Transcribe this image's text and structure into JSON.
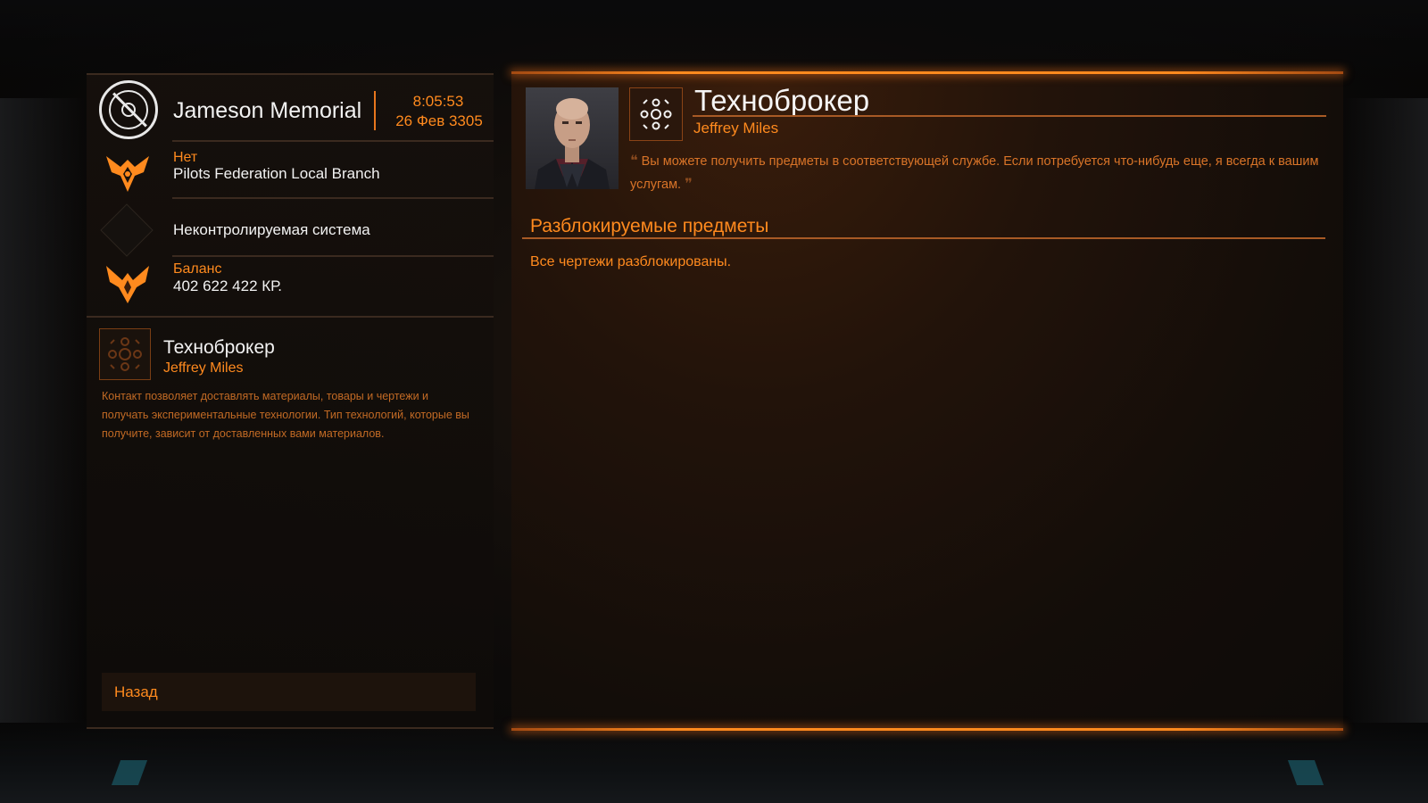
{
  "station": {
    "name": "Jameson Memorial",
    "time": "8:05:53",
    "date": "26 Фев 3305"
  },
  "faction": {
    "label": "Нет",
    "value": "Pilots Federation Local Branch"
  },
  "system_status": "Неконтролируемая система",
  "balance": {
    "label": "Баланс",
    "value": "402 622 422 КР."
  },
  "contact": {
    "title": "Техноброкер",
    "name": "Jeffrey Miles",
    "description": "Контакт позволяет доставлять материалы, товары и чертежи и получать экспериментальные технологии. Тип технологий, которые вы получите, зависит от доставленных вами материалов."
  },
  "back_label": "Назад",
  "broker_panel": {
    "title": "Техноброкер",
    "name": "Jeffrey Miles",
    "quote": "Вы можете получить предметы в соответствующей службе. Если потребуется что-нибудь еще, я всегда к вашим услугам.",
    "section_title": "Разблокируемые предметы",
    "section_text": "Все чертежи разблокированы."
  },
  "colors": {
    "accent": "#ff8a1e",
    "panel_dark": "#130d09",
    "text_primary": "#f2f2f2"
  },
  "icons": {
    "station": "station-target-icon",
    "faction": "pilots-federation-icon",
    "system": "diamond-icon",
    "balance": "elite-wings-icon",
    "broker": "technology-broker-icon"
  }
}
